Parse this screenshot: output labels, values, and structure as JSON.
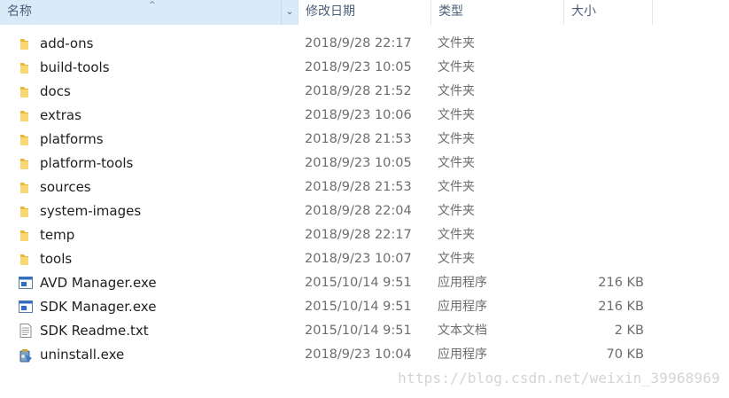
{
  "header": {
    "name": "名称",
    "date": "修改日期",
    "type": "类型",
    "size": "大小"
  },
  "files": [
    {
      "name": "add-ons",
      "date": "2018/9/28 22:17",
      "type": "文件夹",
      "size": "",
      "icon": "folder-icon"
    },
    {
      "name": "build-tools",
      "date": "2018/9/23 10:05",
      "type": "文件夹",
      "size": "",
      "icon": "folder-icon"
    },
    {
      "name": "docs",
      "date": "2018/9/28 21:52",
      "type": "文件夹",
      "size": "",
      "icon": "folder-icon"
    },
    {
      "name": "extras",
      "date": "2018/9/23 10:06",
      "type": "文件夹",
      "size": "",
      "icon": "folder-icon"
    },
    {
      "name": "platforms",
      "date": "2018/9/28 21:53",
      "type": "文件夹",
      "size": "",
      "icon": "folder-icon"
    },
    {
      "name": "platform-tools",
      "date": "2018/9/23 10:05",
      "type": "文件夹",
      "size": "",
      "icon": "folder-icon"
    },
    {
      "name": "sources",
      "date": "2018/9/28 21:53",
      "type": "文件夹",
      "size": "",
      "icon": "folder-icon"
    },
    {
      "name": "system-images",
      "date": "2018/9/28 22:04",
      "type": "文件夹",
      "size": "",
      "icon": "folder-icon"
    },
    {
      "name": "temp",
      "date": "2018/9/28 22:17",
      "type": "文件夹",
      "size": "",
      "icon": "folder-icon"
    },
    {
      "name": "tools",
      "date": "2018/9/23 10:07",
      "type": "文件夹",
      "size": "",
      "icon": "folder-icon"
    },
    {
      "name": "AVD Manager.exe",
      "date": "2015/10/14 9:51",
      "type": "应用程序",
      "size": "216 KB",
      "icon": "application-icon"
    },
    {
      "name": "SDK Manager.exe",
      "date": "2015/10/14 9:51",
      "type": "应用程序",
      "size": "216 KB",
      "icon": "application-icon"
    },
    {
      "name": "SDK Readme.txt",
      "date": "2015/10/14 9:51",
      "type": "文本文档",
      "size": "2 KB",
      "icon": "text-file-icon"
    },
    {
      "name": "uninstall.exe",
      "date": "2018/9/23 10:04",
      "type": "应用程序",
      "size": "70 KB",
      "icon": "uninstaller-icon"
    }
  ],
  "watermark": "https://blog.csdn.net/weixin_39968969"
}
